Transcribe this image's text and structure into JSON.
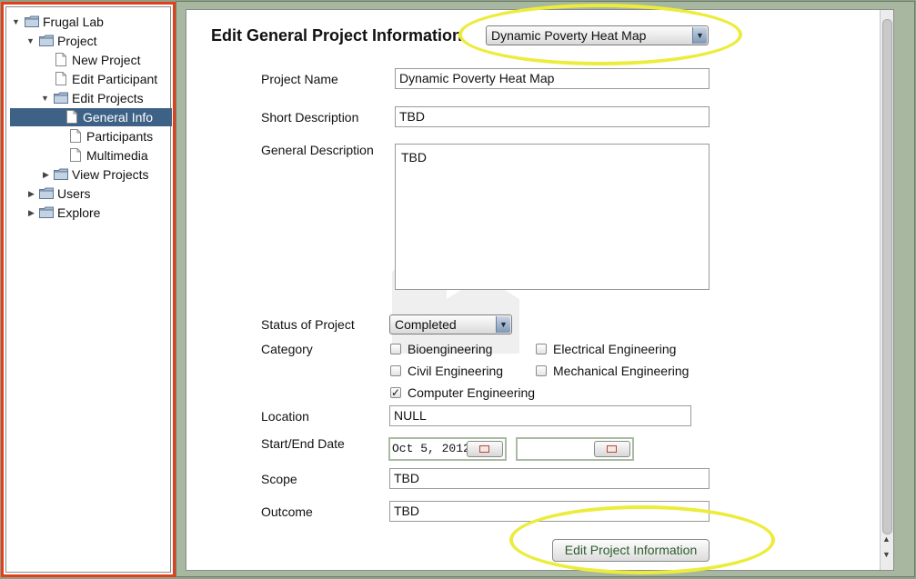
{
  "tree": {
    "items": [
      {
        "label": "Frugal Lab",
        "icon": "folder-icon",
        "expanded": true
      },
      {
        "label": "Project",
        "icon": "folder-icon",
        "expanded": true
      },
      {
        "label": "New Project",
        "icon": "document-icon"
      },
      {
        "label": "Edit Participant",
        "icon": "document-icon"
      },
      {
        "label": "Edit Projects",
        "icon": "folder-icon",
        "expanded": true
      },
      {
        "label": "General Info",
        "icon": "document-icon",
        "selected": true
      },
      {
        "label": "Participants",
        "icon": "document-icon"
      },
      {
        "label": "Multimedia",
        "icon": "document-icon"
      },
      {
        "label": "View Projects",
        "icon": "folder-icon",
        "expanded": false
      },
      {
        "label": "Users",
        "icon": "folder-icon",
        "expanded": false
      },
      {
        "label": "Explore",
        "icon": "folder-icon",
        "expanded": false
      }
    ]
  },
  "form": {
    "title": "Edit General Project Information",
    "project_selector": "Dynamic Poverty Heat Map",
    "labels": {
      "project_name": "Project Name",
      "short_description": "Short Description",
      "general_description": "General Description",
      "status": "Status of Project",
      "category": "Category",
      "location": "Location",
      "start_end_date": "Start/End Date",
      "scope": "Scope",
      "outcome": "Outcome"
    },
    "values": {
      "project_name": "Dynamic Poverty Heat Map",
      "short_description": "TBD",
      "general_description": "TBD",
      "status": "Completed",
      "location": "NULL",
      "start_date": "Oct 5, 2012",
      "end_date": "",
      "scope": "TBD",
      "outcome": "TBD"
    },
    "categories": [
      {
        "label": "Bioengineering",
        "checked": false
      },
      {
        "label": "Electrical Engineering",
        "checked": false
      },
      {
        "label": "Civil Engineering",
        "checked": false
      },
      {
        "label": "Mechanical Engineering",
        "checked": false
      },
      {
        "label": "Computer Engineering",
        "checked": true
      }
    ],
    "submit_label": "Edit Project Information"
  },
  "colors": {
    "tree_border": "#e2401a",
    "selection": "#3d6286",
    "highlight": "#ecec3c",
    "frame_background": "#a7b7a0"
  }
}
